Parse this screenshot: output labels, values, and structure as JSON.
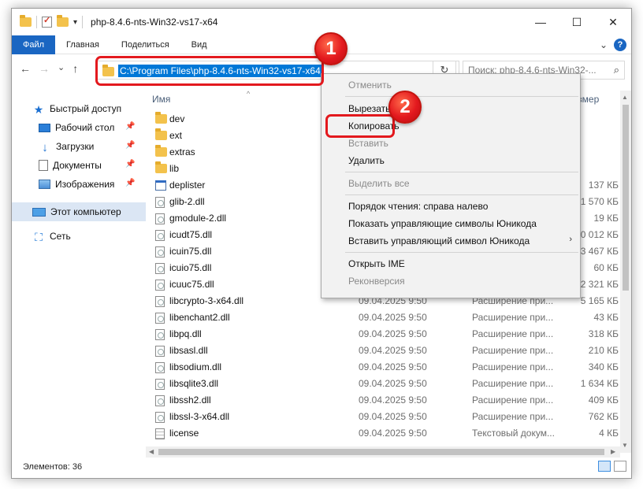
{
  "window": {
    "title": "php-8.4.6-nts-Win32-vs17-x64",
    "minimize": "—",
    "maximize": "☐",
    "close": "✕",
    "qa_dropdown": "▾"
  },
  "ribbon": {
    "tabs": [
      "Файл",
      "Главная",
      "Поделиться",
      "Вид"
    ],
    "expand": "⌄",
    "help": "?"
  },
  "nav": {
    "back": "←",
    "forward": "→",
    "recent": "⌄",
    "up": "↑",
    "address_path": "C:\\Program Files\\php-8.4.6-nts-Win32-vs17-x64",
    "refresh": "↻",
    "search_placeholder": "Поиск: php-8.4.6-nts-Win32-...",
    "search_icon": "⌕"
  },
  "sidebar": {
    "quick_access": "Быстрый доступ",
    "items": [
      "Рабочий стол",
      "Загрузки",
      "Документы",
      "Изображения"
    ],
    "this_pc": "Этот компьютер",
    "network": "Сеть",
    "pin": "📌"
  },
  "columns": {
    "name": "Имя",
    "size": "Размер",
    "sort": "^"
  },
  "files": [
    {
      "name": "dev",
      "type_icon": "folder",
      "date": "",
      "kind": "",
      "size": ""
    },
    {
      "name": "ext",
      "type_icon": "folder",
      "date": "",
      "kind": "",
      "size": ""
    },
    {
      "name": "extras",
      "type_icon": "folder",
      "date": "",
      "kind": "",
      "size": ""
    },
    {
      "name": "lib",
      "type_icon": "folder",
      "date": "",
      "kind": "",
      "size": ""
    },
    {
      "name": "deplister",
      "type_icon": "exe",
      "date": "",
      "kind": "",
      "size": "137 КБ"
    },
    {
      "name": "glib-2.dll",
      "type_icon": "dll",
      "date": "",
      "kind": "",
      "size": "1 570 КБ"
    },
    {
      "name": "gmodule-2.dll",
      "type_icon": "dll",
      "date": "",
      "kind": "",
      "size": "19 КБ"
    },
    {
      "name": "icudt75.dll",
      "type_icon": "dll",
      "date": "",
      "kind": "",
      "size": "30 012 КБ"
    },
    {
      "name": "icuin75.dll",
      "type_icon": "dll",
      "date": "",
      "kind": "",
      "size": "3 467 КБ"
    },
    {
      "name": "icuio75.dll",
      "type_icon": "dll",
      "date": "",
      "kind": "",
      "size": "60 КБ"
    },
    {
      "name": "icuuc75.dll",
      "type_icon": "dll",
      "date": "",
      "kind": "",
      "size": "2 321 КБ"
    },
    {
      "name": "libcrypto-3-x64.dll",
      "type_icon": "dll",
      "date": "09.04.2025 9:50",
      "kind": "Расширение при...",
      "size": "5 165 КБ"
    },
    {
      "name": "libenchant2.dll",
      "type_icon": "dll",
      "date": "09.04.2025 9:50",
      "kind": "Расширение при...",
      "size": "43 КБ"
    },
    {
      "name": "libpq.dll",
      "type_icon": "dll",
      "date": "09.04.2025 9:50",
      "kind": "Расширение при...",
      "size": "318 КБ"
    },
    {
      "name": "libsasl.dll",
      "type_icon": "dll",
      "date": "09.04.2025 9:50",
      "kind": "Расширение при...",
      "size": "210 КБ"
    },
    {
      "name": "libsodium.dll",
      "type_icon": "dll",
      "date": "09.04.2025 9:50",
      "kind": "Расширение при...",
      "size": "340 КБ"
    },
    {
      "name": "libsqlite3.dll",
      "type_icon": "dll",
      "date": "09.04.2025 9:50",
      "kind": "Расширение при...",
      "size": "1 634 КБ"
    },
    {
      "name": "libssh2.dll",
      "type_icon": "dll",
      "date": "09.04.2025 9:50",
      "kind": "Расширение при...",
      "size": "409 КБ"
    },
    {
      "name": "libssl-3-x64.dll",
      "type_icon": "dll",
      "date": "09.04.2025 9:50",
      "kind": "Расширение при...",
      "size": "762 КБ"
    },
    {
      "name": "license",
      "type_icon": "txt",
      "date": "09.04.2025 9:50",
      "kind": "Текстовый докум...",
      "size": "4 КБ"
    }
  ],
  "context_menu": {
    "undo": "Отменить",
    "cut": "Вырезать",
    "copy": "Копировать",
    "paste": "Вставить",
    "delete": "Удалить",
    "select_all": "Выделить все",
    "rtl": "Порядок чтения: справа налево",
    "show_unicode": "Показать управляющие символы Юникода",
    "insert_unicode": "Вставить управляющий символ Юникода",
    "submenu_arrow": "›",
    "open_ime": "Открыть IME",
    "reconversion": "Реконверсия"
  },
  "badges": {
    "one": "1",
    "two": "2"
  },
  "status": {
    "items_count": "Элементов: 36"
  },
  "colors": {
    "accent": "#1a66c2",
    "selection": "#0078d7",
    "highlight_red": "#e3191e",
    "folder": "#f3c24c"
  }
}
